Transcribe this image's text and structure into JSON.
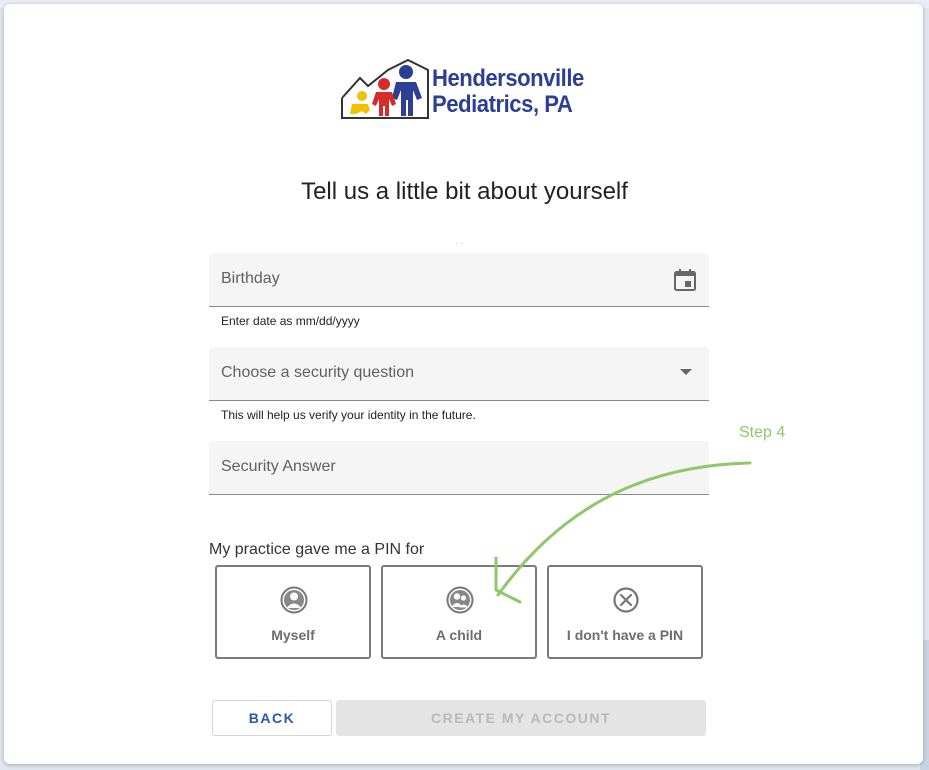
{
  "logo": {
    "line1": "Hendersonville",
    "line2": "Pediatrics, PA"
  },
  "title": "Tell us a little bit about yourself",
  "birthday": {
    "label": "Birthday",
    "hint": "Enter date as mm/dd/yyyy",
    "icon": "calendar-icon"
  },
  "security_question": {
    "label": "Choose a security question",
    "hint": "This will help us verify your identity in the future.",
    "icon": "dropdown-arrow-icon"
  },
  "security_answer": {
    "label": "Security Answer"
  },
  "pin": {
    "label": "My practice gave me a PIN for",
    "options": [
      {
        "label": "Myself",
        "icon": "person-icon"
      },
      {
        "label": "A child",
        "icon": "people-icon"
      },
      {
        "label": "I don't have a PIN",
        "icon": "x-circle-icon"
      }
    ]
  },
  "buttons": {
    "back": "BACK",
    "create": "CREATE MY ACCOUNT"
  },
  "annotation": {
    "step": "Step 4",
    "color": "#8dc86a"
  },
  "colors": {
    "brand": "#2c3f95",
    "accent": "#2a5aa8",
    "disabled_bg": "#e4e4e4"
  }
}
